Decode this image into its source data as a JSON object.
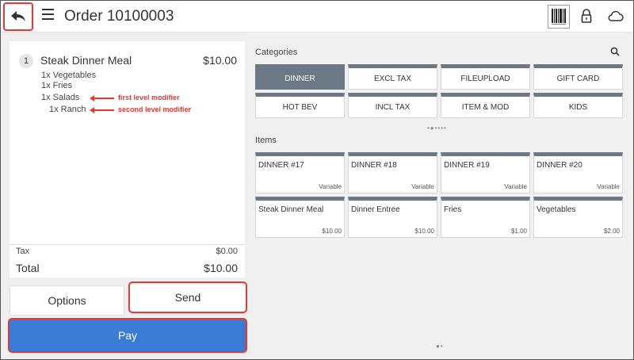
{
  "header": {
    "title": "Order 10100003"
  },
  "order": {
    "line_qty": "1",
    "item_name": "Steak Dinner Meal",
    "item_price": "$10.00",
    "modifiers": [
      "1x  Vegetables",
      "1x  Fries",
      "1x  Salads",
      "1x  Ranch"
    ],
    "annotations": {
      "first": "first level modifier",
      "second": "second level modifier"
    },
    "tax_label": "Tax",
    "tax_value": "$0.00",
    "total_label": "Total",
    "total_value": "$10.00"
  },
  "actions": {
    "options": "Options",
    "send": "Send",
    "pay": "Pay"
  },
  "categories": {
    "label": "Categories",
    "items": [
      "DINNER",
      "EXCL TAX",
      "FILEUPLOAD",
      "GIFT CARD",
      "HOT BEV",
      "INCL TAX",
      "ITEM & MOD",
      "KIDS"
    ],
    "selected": "DINNER",
    "pager": "•●••••"
  },
  "items": {
    "label": "Items",
    "tiles": [
      {
        "name": "DINNER #17",
        "price": "Variable"
      },
      {
        "name": "DINNER #18",
        "price": "Variable"
      },
      {
        "name": "DINNER #19",
        "price": "Variable"
      },
      {
        "name": "DINNER #20",
        "price": "Variable"
      },
      {
        "name": "Steak Dinner Meal",
        "price": "$10.00"
      },
      {
        "name": "Dinner Entree",
        "price": "$10.00"
      },
      {
        "name": "Fries",
        "price": "$1.00"
      },
      {
        "name": "Vegetables",
        "price": "$2.00"
      }
    ],
    "pager": "●•"
  },
  "colors": {
    "accent": "#3a7bd5",
    "highlight": "#e53935",
    "tile_bar": "#6b7886"
  }
}
